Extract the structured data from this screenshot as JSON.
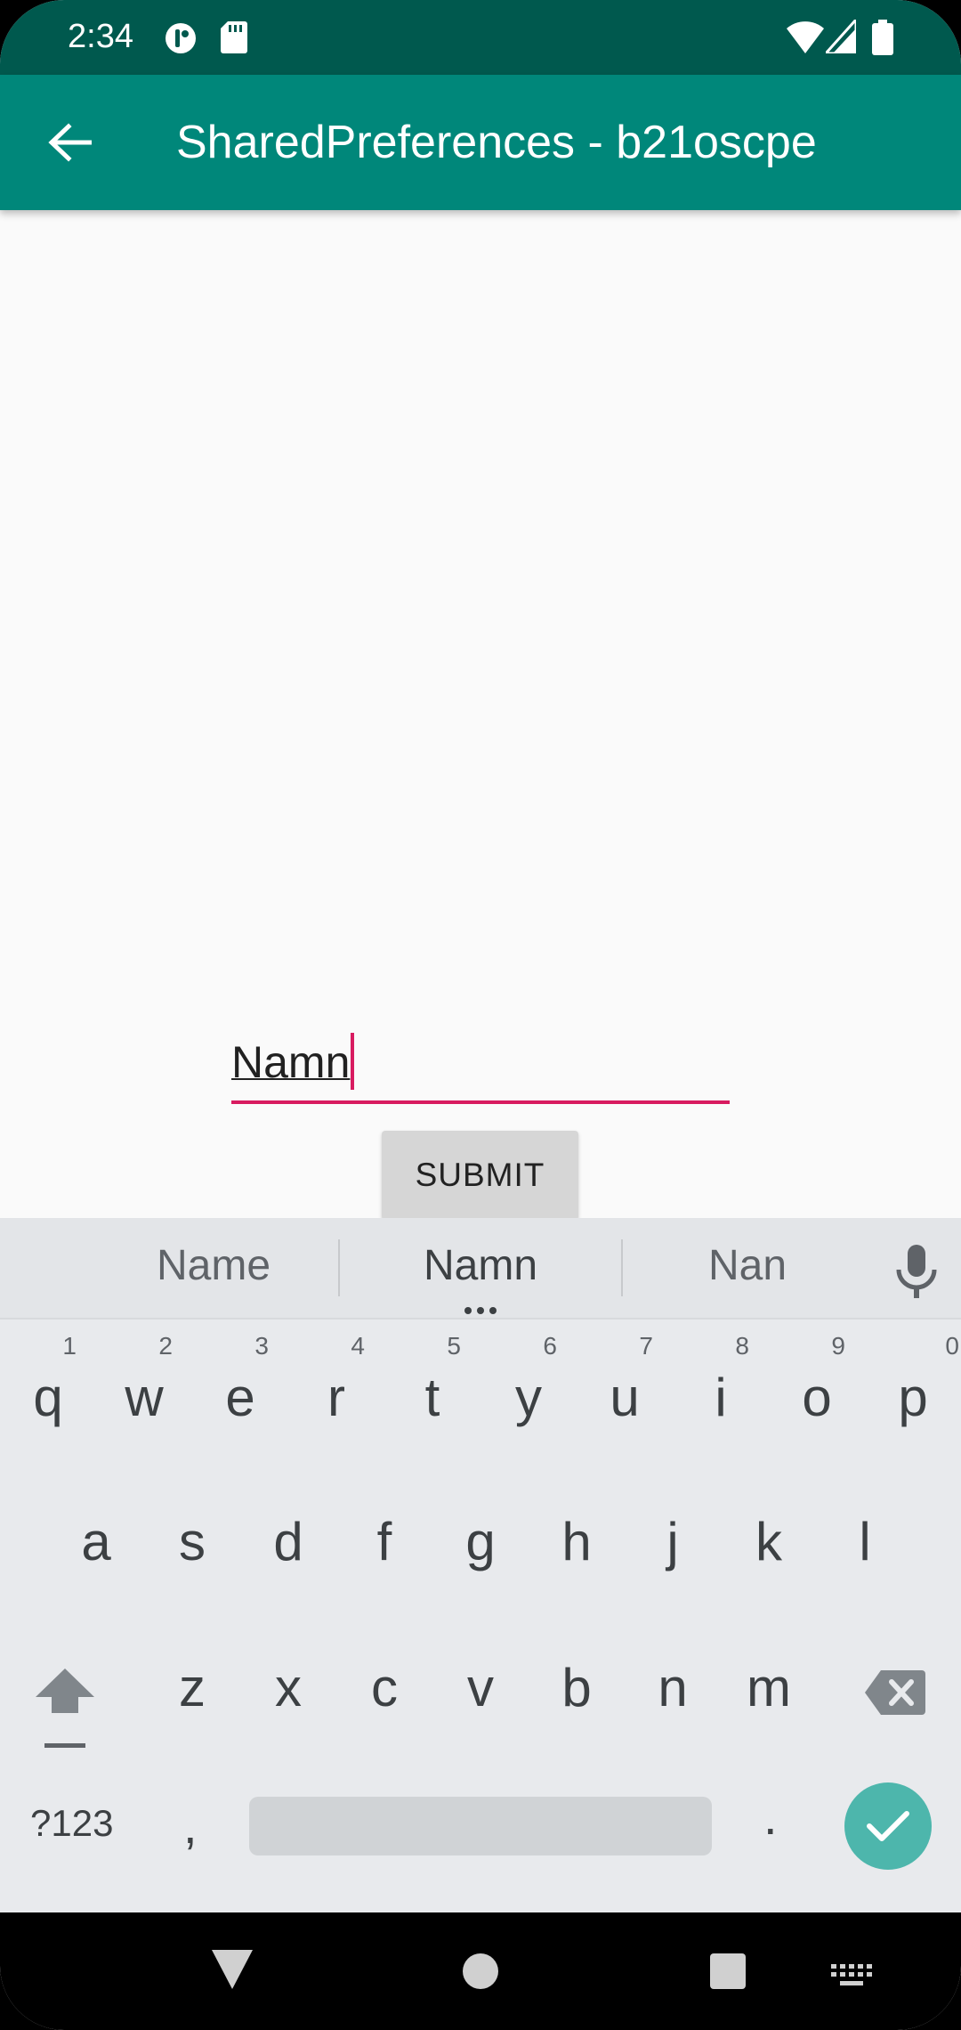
{
  "status_bar": {
    "time": "2:34"
  },
  "app_bar": {
    "title": "SharedPreferences - b21oscpe"
  },
  "form": {
    "name_value": "Namn",
    "submit_label": "SUBMIT"
  },
  "keyboard": {
    "suggestions": [
      "Name",
      "Namn",
      "Nan"
    ],
    "row1": [
      {
        "ch": "q",
        "hint": "1"
      },
      {
        "ch": "w",
        "hint": "2"
      },
      {
        "ch": "e",
        "hint": "3"
      },
      {
        "ch": "r",
        "hint": "4"
      },
      {
        "ch": "t",
        "hint": "5"
      },
      {
        "ch": "y",
        "hint": "6"
      },
      {
        "ch": "u",
        "hint": "7"
      },
      {
        "ch": "i",
        "hint": "8"
      },
      {
        "ch": "o",
        "hint": "9"
      },
      {
        "ch": "p",
        "hint": "0"
      }
    ],
    "row2": [
      "a",
      "s",
      "d",
      "f",
      "g",
      "h",
      "j",
      "k",
      "l"
    ],
    "row3": [
      "z",
      "x",
      "c",
      "v",
      "b",
      "n",
      "m"
    ],
    "symbols_label": "?123",
    "comma_label": ",",
    "period_label": "."
  },
  "colors": {
    "status_bar": "#00594e",
    "app_bar": "#00877a",
    "accent": "#d81b60",
    "enter_key": "#4db6ac"
  }
}
